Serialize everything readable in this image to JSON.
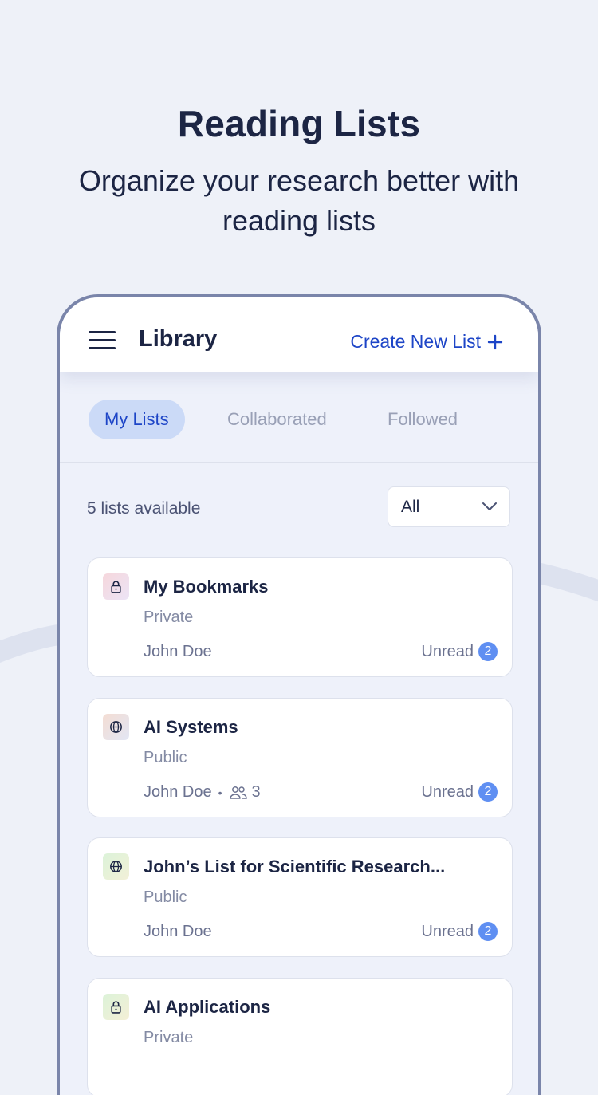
{
  "promo": {
    "title": "Reading Lists",
    "subtitle": "Organize your research better with reading lists"
  },
  "header": {
    "title": "Library",
    "create_label": "Create New List"
  },
  "tabs": [
    {
      "label": "My Lists",
      "active": true
    },
    {
      "label": "Collaborated",
      "active": false
    },
    {
      "label": "Followed",
      "active": false
    }
  ],
  "list_count": "5 lists available",
  "filter": {
    "selected": "All"
  },
  "lists": [
    {
      "title": "My Bookmarks",
      "visibility": "Private",
      "owner": "John Doe",
      "collaborators": "",
      "unread_label": "Unread",
      "unread_count": "2",
      "icon": "lock-icon"
    },
    {
      "title": "AI Systems",
      "visibility": "Public",
      "owner": "John Doe",
      "collaborators": "3",
      "unread_label": "Unread",
      "unread_count": "2",
      "icon": "globe-icon"
    },
    {
      "title": "John’s List for Scientific Research...",
      "visibility": "Public",
      "owner": "John Doe",
      "collaborators": "",
      "unread_label": "Unread",
      "unread_count": "2",
      "icon": "globe-icon"
    },
    {
      "title": "AI Applications",
      "visibility": "Private",
      "owner": "",
      "collaborators": "",
      "unread_label": "",
      "unread_count": "",
      "icon": "lock-icon"
    }
  ],
  "colors": {
    "accent": "#1d45c7",
    "badge": "#5f8ff2",
    "background": "#eef1f8",
    "text": "#1c2544"
  }
}
